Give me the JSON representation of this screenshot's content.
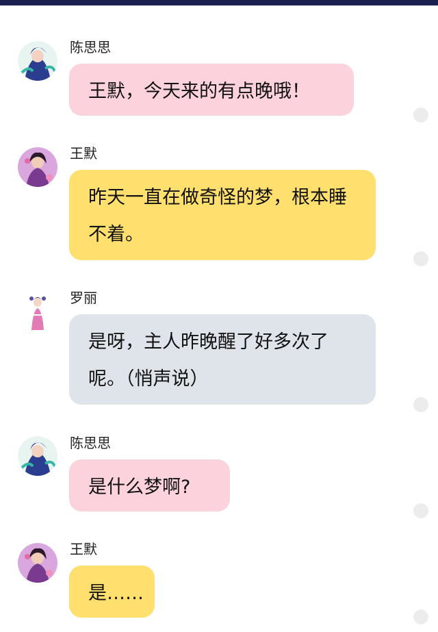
{
  "messages": [
    {
      "sender": "陈思思",
      "text": "王默，今天来的有点晚哦！",
      "bubble_color": "#fcd3dd",
      "avatar": "avatar-chen-sisi"
    },
    {
      "sender": "王默",
      "text": "昨天一直在做奇怪的梦，根本睡不着。",
      "bubble_color": "#ffdf6e",
      "avatar": "avatar-wang-mo"
    },
    {
      "sender": "罗丽",
      "text": "是呀，主人昨晚醒了好多次了呢。（悄声说）",
      "bubble_color": "#dfe4eb",
      "avatar": "avatar-luo-li"
    },
    {
      "sender": "陈思思",
      "text": "是什么梦啊?",
      "bubble_color": "#fcd3dd",
      "avatar": "avatar-chen-sisi"
    },
    {
      "sender": "王默",
      "text": "是……",
      "bubble_color": "#ffdf6e",
      "avatar": "avatar-wang-mo"
    }
  ],
  "colors": {
    "top_bar": "#1a1f4f",
    "pink_bubble": "#fcd3dd",
    "yellow_bubble": "#ffdf6e",
    "gray_bubble": "#dfe4eb"
  }
}
